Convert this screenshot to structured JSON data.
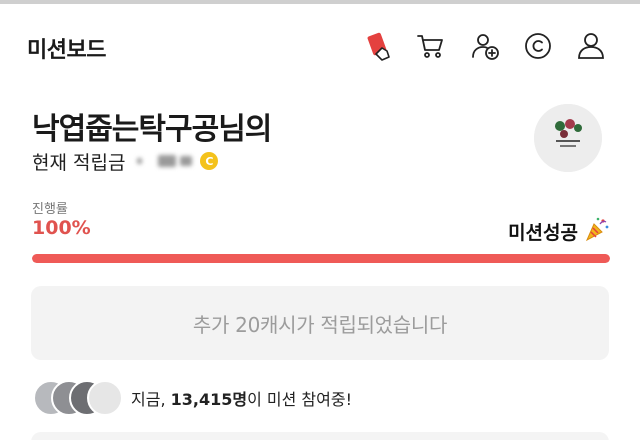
{
  "header": {
    "title": "미션보드",
    "icons": [
      "mission-card-icon",
      "cart-icon",
      "add-friend-icon",
      "coin-c-icon",
      "profile-icon"
    ]
  },
  "user": {
    "name": "낙엽줍는탁구공님의",
    "points_label": "현재 적립금",
    "points_hidden": true
  },
  "progress": {
    "label": "진행률",
    "value_text": "100%",
    "value": 1.0,
    "status": "미션성공"
  },
  "banner": {
    "text": "추가 20캐시가 적립되었습니다"
  },
  "participants": {
    "prefix": "지금, ",
    "count": "13,415명",
    "suffix": "이 미션 참여중!"
  },
  "colors": {
    "accent": "#ef5a57",
    "progress_text": "#e0534f",
    "banner_bg": "#f3f3f3",
    "banner_text": "#9c9c9c",
    "coin": "#f4c21b"
  }
}
